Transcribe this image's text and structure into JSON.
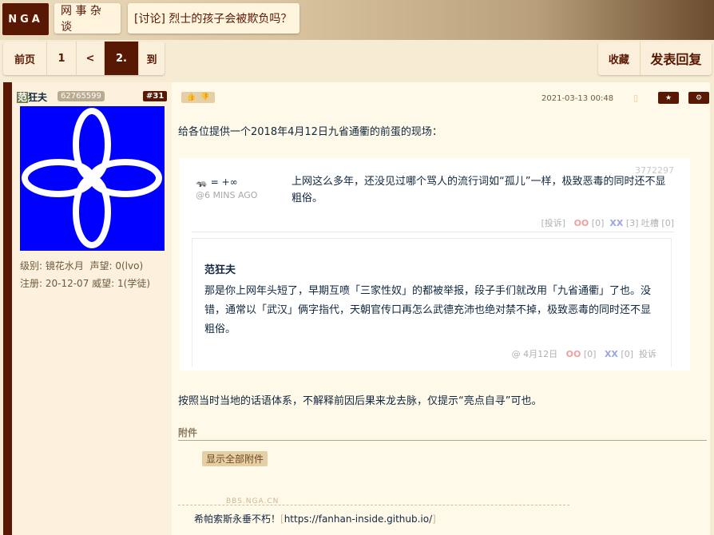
{
  "header": {
    "logo": "NGA",
    "forum": "网 事 杂 谈",
    "thread_title": "[讨论] 烈士的孩子会被欺负吗？"
  },
  "pager": {
    "first": "前页",
    "page1": "1",
    "prev": "<",
    "current": "2.",
    "goto": "到"
  },
  "actions": {
    "favorite": "收藏",
    "reply": "发表回复"
  },
  "post": {
    "author": "范狂夫",
    "author_first_char": "范",
    "author_rest": "狂夫",
    "uid": "62765599",
    "floor": "#31",
    "level": "级别: 镜花水月",
    "fame": "声望: 0(lvo)",
    "registered": "注册: 20-12-07",
    "prestige": "威望: 1(学徒)",
    "date": "2021-03-13 00:48",
    "intro": "给各位提供一个2018年4月12日九省通衢的前蛋的现场：",
    "quote": {
      "user": "🦡 = +∞",
      "time": "@6 MINS AGO",
      "id": "3772297",
      "text": "上网这么多年，还没见过哪个骂人的流行词如“孤儿”一样，极致恶毒的同时还不显粗俗。",
      "report": "[投诉]",
      "like_icon": "OO",
      "like_count": "[0]",
      "dislike_icon": "XX",
      "dislike_count": "[3] 吐槽 [0]"
    },
    "reply": {
      "user": "范狂夫",
      "text": "那是你上网年头短了，早期互喷「三家性奴」的都被举报，段子手们就改用「九省通衢」了也。没错，通常以「武汉」俩字指代，天朝官传口再怎么武德充沛也绝对禁不掉，极致恶毒的同时还不显粗俗。",
      "time": "@  4月12日",
      "like_icon": "OO",
      "like_count": "[0]",
      "dislike_icon": "XX",
      "dislike_count": "[0]",
      "report": "投诉"
    },
    "closing": "按照当时当地的话语体系，不解释前因后果来龙去脉，仅提示“亮点自寻”可也。",
    "attachments_title": "附件",
    "show_attachments": "显示全部附件",
    "watermark": "BBS.NGA.CN",
    "signature": "希帕索斯永垂不朽！",
    "signature_link": "https://fanhan-inside.github.io/"
  }
}
